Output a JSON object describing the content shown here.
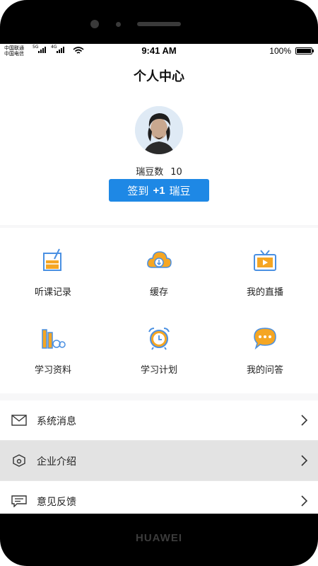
{
  "status_bar": {
    "carrier_1": "中国联通",
    "carrier_2": "中国电信",
    "net_1": "5G",
    "net_2": "4G",
    "time": "9:41 AM",
    "battery": "100%",
    "battery_level": 1.0
  },
  "header": {
    "title": "个人中心"
  },
  "profile": {
    "beans_label": "瑞豆数",
    "beans_value": "10",
    "checkin": {
      "label": "签到",
      "plus": "+1",
      "unit": "瑞豆"
    }
  },
  "grid": {
    "items": [
      {
        "label": "听课记录",
        "icon": "study-record-icon"
      },
      {
        "label": "缓存",
        "icon": "cloud-download-icon"
      },
      {
        "label": "我的直播",
        "icon": "live-tv-icon"
      },
      {
        "label": "学习资料",
        "icon": "books-icon"
      },
      {
        "label": "学习计划",
        "icon": "alarm-clock-icon"
      },
      {
        "label": "我的问答",
        "icon": "chat-bubble-icon"
      }
    ]
  },
  "menu": {
    "items": [
      {
        "label": "系统消息",
        "icon": "mail-icon"
      },
      {
        "label": "企业介绍",
        "icon": "company-icon"
      },
      {
        "label": "意见反馈",
        "icon": "feedback-icon"
      }
    ]
  },
  "device": {
    "brand": "HUAWEI"
  },
  "colors": {
    "accent": "#1e88e5",
    "icon_orange": "#f5a623",
    "icon_blue": "#4a90e2"
  }
}
